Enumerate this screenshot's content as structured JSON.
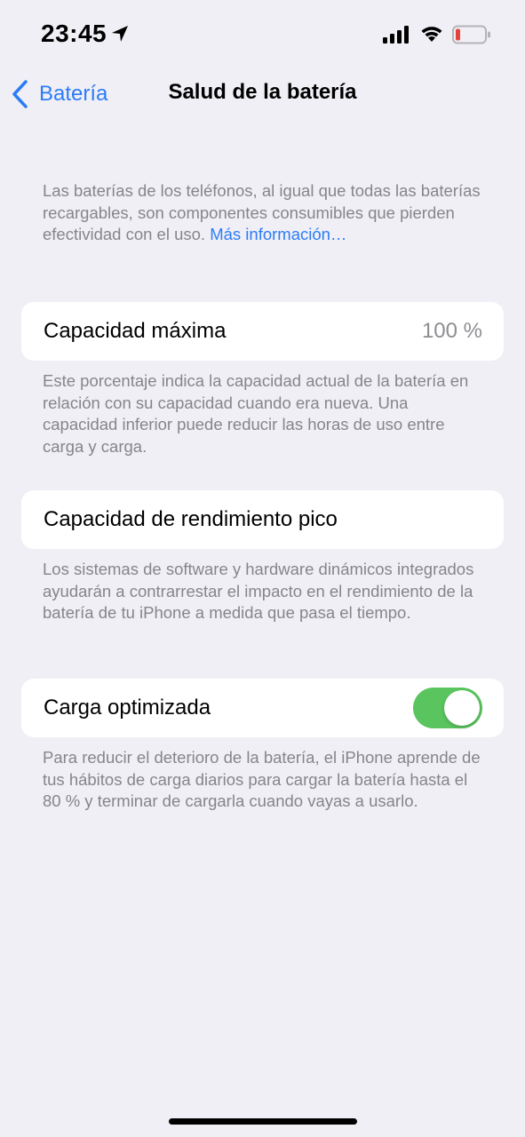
{
  "status_bar": {
    "time": "23:45",
    "icons": [
      "location-arrow-icon",
      "cellular-signal-icon",
      "wifi-icon",
      "battery-low-icon"
    ],
    "battery_color": "#e5433a"
  },
  "nav": {
    "back_label": "Batería",
    "title": "Salud de la batería"
  },
  "intro": {
    "text": "Las baterías de los teléfonos, al igual que todas las baterías recargables, son componentes consumibles que pierden efectividad con el uso.",
    "link": "Más información…"
  },
  "max_capacity": {
    "label": "Capacidad máxima",
    "value": "100 %",
    "footer": "Este porcentaje indica la capacidad actual de la batería en relación con su capacidad cuando era nueva. Una capacidad inferior puede reducir las horas de uso entre carga y carga."
  },
  "peak_performance": {
    "label": "Capacidad de rendimiento pico",
    "footer": "Los sistemas de software y hardware dinámicos integrados ayudarán a contrarrestar el impacto en el rendimiento de la batería de tu iPhone a medida que pasa el tiempo."
  },
  "optimized_charging": {
    "label": "Carga optimizada",
    "enabled": true,
    "footer": "Para reducir el deterioro de la batería, el iPhone aprende de tus hábitos de carga diarios para cargar la batería hasta el 80 % y terminar de cargarla cuando vayas a usarlo."
  },
  "colors": {
    "accent": "#2d7cf6",
    "toggle_on": "#5ac45e",
    "background": "#f0eff5",
    "secondary_text": "#86858b"
  }
}
